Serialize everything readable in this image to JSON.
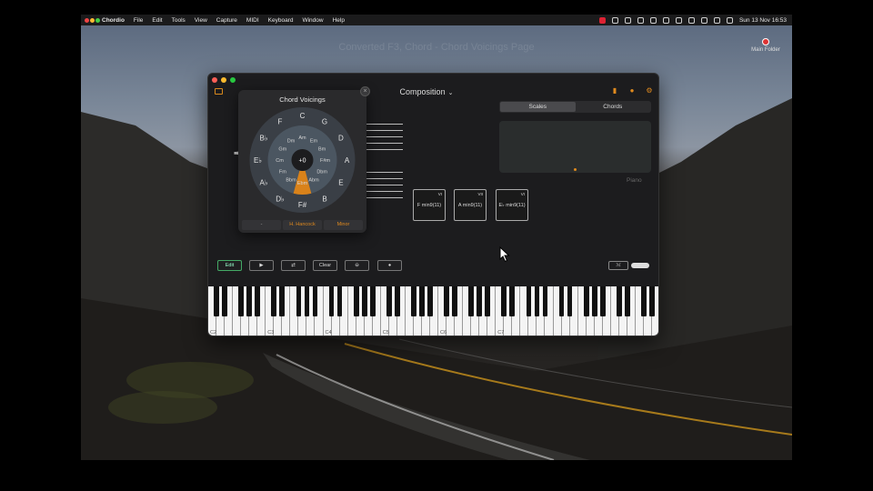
{
  "menubar": {
    "app_name": "Chordio",
    "menus": [
      "File",
      "Edit",
      "Tools",
      "View",
      "Capture",
      "MIDI",
      "Keyboard",
      "Window",
      "Help"
    ],
    "datetime": "Sun 13 Nov  16:53"
  },
  "desktop": {
    "background_window_title": "Converted F3, Chord - Chord Voicings Page",
    "desktop_icon_label": "Main Folder"
  },
  "app": {
    "title": "Composition",
    "tabs": [
      {
        "label": "Scales",
        "active": true
      },
      {
        "label": "Chords",
        "active": false
      }
    ],
    "instrument_label": "Piano",
    "chord_cards": [
      {
        "numeral": "VI",
        "name": "F min9(11)"
      },
      {
        "numeral": "VII",
        "name": "A min9(11)"
      },
      {
        "numeral": "VI",
        "name": "E♭ min9(11)"
      }
    ],
    "toolbar": {
      "edit_label": "Edit",
      "clear_label": "Clear"
    },
    "keyboard_labels": [
      "C2",
      "C3",
      "C4",
      "C5",
      "C6",
      "C7"
    ]
  },
  "popup": {
    "title": "Chord Voicings",
    "center_label": "+0",
    "outer_ring": [
      "C",
      "G",
      "D",
      "A",
      "E",
      "B",
      "F#",
      "D♭",
      "A♭",
      "E♭",
      "B♭",
      "F"
    ],
    "inner_ring": [
      "Am",
      "Em",
      "Bm",
      "F#m",
      "Dbm",
      "Abm",
      "Ebm",
      "Bbm",
      "Fm",
      "Cm",
      "Gm",
      "Dm"
    ],
    "buttons": [
      {
        "label": "-",
        "accent": false
      },
      {
        "label": "H. Hancock",
        "accent": true
      },
      {
        "label": "Minor",
        "accent": true
      }
    ],
    "highlight_color": "#d9821a"
  },
  "colors": {
    "accent": "#e08a1e",
    "window_bg": "#1c1c1e"
  }
}
